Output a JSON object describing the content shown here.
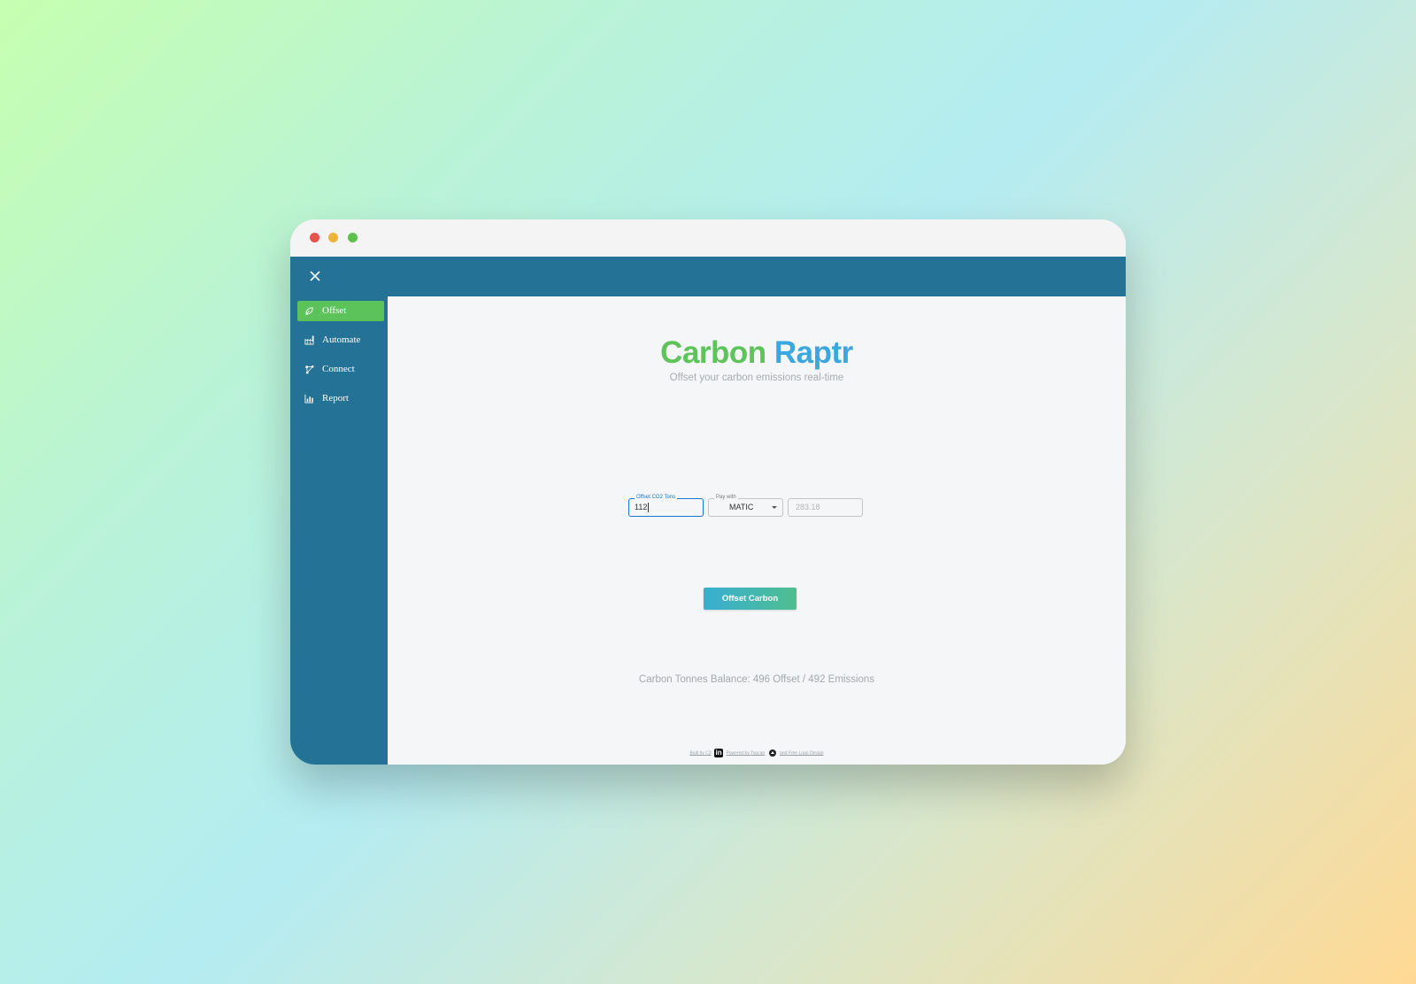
{
  "app": {
    "brand_word1": "Carbon",
    "brand_word2": "Raptr",
    "tagline": "Offset your carbon emissions real-time"
  },
  "colors": {
    "appbar": "#247295",
    "nav_active": "#5cc35a",
    "brand_green": "#5ec35b",
    "brand_blue": "#3aa8de",
    "input_focus": "#1976d2"
  },
  "sidebar": {
    "items": [
      {
        "label": "Offset",
        "icon": "leaf-icon",
        "active": true
      },
      {
        "label": "Automate",
        "icon": "factory-icon",
        "active": false
      },
      {
        "label": "Connect",
        "icon": "network-icon",
        "active": false
      },
      {
        "label": "Report",
        "icon": "bar-chart-icon",
        "active": false
      }
    ]
  },
  "form": {
    "co2_label": "Offset CO2 Tons",
    "co2_value": "112",
    "pay_label": "Pay with",
    "pay_value": "MATIC",
    "cost_value": "283.18",
    "submit_label": "Offset Carbon"
  },
  "balance": {
    "text": "Carbon Tonnes Balance: 496 Offset / 492 Emissions"
  },
  "footer": {
    "built_by": "Built by C3",
    "linkedin_icon": "linkedin-icon",
    "powered_by": "Powered by Toucan",
    "logo_design": "and Free Logo Design"
  }
}
